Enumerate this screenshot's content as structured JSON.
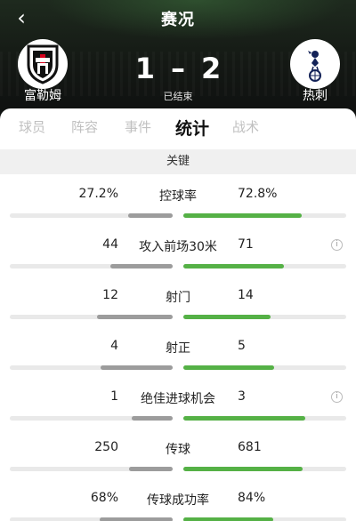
{
  "header": {
    "back_glyph": "‹",
    "title": "赛况",
    "status": "已结束"
  },
  "home": {
    "name": "富勒姆",
    "score": "1",
    "crest_icon": "fulham-crest-icon"
  },
  "away": {
    "name": "热刺",
    "score": "2",
    "crest_icon": "tottenham-crest-icon"
  },
  "score_separator": "–",
  "tabs": [
    {
      "label": "球员",
      "active": false
    },
    {
      "label": "阵容",
      "active": false
    },
    {
      "label": "事件",
      "active": false
    },
    {
      "label": "统计",
      "active": true
    },
    {
      "label": "战术",
      "active": false
    }
  ],
  "section_title": "关键",
  "stats": [
    {
      "label": "控球率",
      "home": "27.2%",
      "away": "72.8%",
      "home_share": 0.272,
      "away_share": 0.728,
      "info": false
    },
    {
      "label": "攻入前场30米",
      "home": "44",
      "away": "71",
      "home_share": 0.383,
      "away_share": 0.617,
      "info": true
    },
    {
      "label": "射门",
      "home": "12",
      "away": "14",
      "home_share": 0.462,
      "away_share": 0.538,
      "info": false
    },
    {
      "label": "射正",
      "home": "4",
      "away": "5",
      "home_share": 0.444,
      "away_share": 0.556,
      "info": false
    },
    {
      "label": "绝佳进球机会",
      "home": "1",
      "away": "3",
      "home_share": 0.25,
      "away_share": 0.75,
      "info": true
    },
    {
      "label": "传球",
      "home": "250",
      "away": "681",
      "home_share": 0.269,
      "away_share": 0.731,
      "info": false
    },
    {
      "label": "传球成功率",
      "home": "68%",
      "away": "84%",
      "home_share": 0.447,
      "away_share": 0.553,
      "info": false
    }
  ],
  "info_glyph": "i",
  "colors": {
    "home_bar": "#9c9c9c",
    "away_bar": "#55b146",
    "track": "#e9e9e9"
  }
}
